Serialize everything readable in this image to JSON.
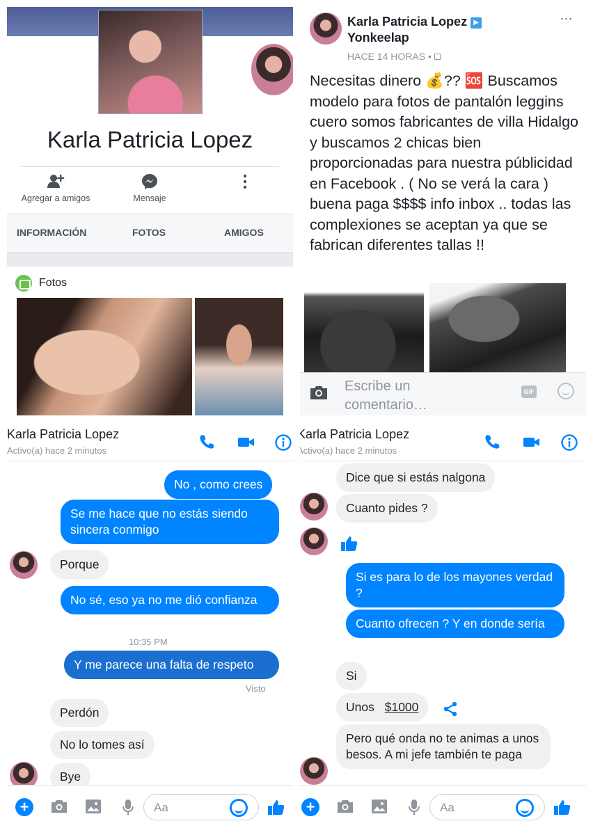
{
  "profile": {
    "name": "Karla Patricia Lopez",
    "actions": [
      {
        "label": "Agregar a amigos",
        "icon": "add-friend-icon"
      },
      {
        "label": "Mensaje",
        "icon": "messenger-icon"
      },
      {
        "label": "",
        "icon": "more-vertical-icon"
      }
    ],
    "tabs": [
      "INFORMACIÓN",
      "FOTOS",
      "AMIGOS"
    ],
    "photos_title": "Fotos"
  },
  "post": {
    "author": "Karla Patricia Lopez",
    "author_line2": "Yonkeelap",
    "time": "HACE 14 HORAS •",
    "text": "Necesitas dinero 💰?? 🆘 Buscamos modelo para fotos de pantalón leggins cuero somos fabricantes de villa Hidalgo y buscamos 2 chicas bien proporcionadas para nuestra públicidad en Facebook . ( No se verá la cara )  buena paga $$$$ info inbox ..  todas las complexiones se aceptan ya que se fabrican diferentes tallas !!",
    "more": "...",
    "comment_placeholder": "Escribe un comentario…",
    "gif_label": "GIF"
  },
  "chat1": {
    "name": "Karla Patricia Lopez",
    "status": "Activo(a) hace 2 minutos",
    "messages": [
      "No , como crees",
      "Se me hace que no estás siendo sincera conmigo",
      "Porque",
      "No sé, eso ya no me dió confianza",
      "Y me parece una falta de respeto",
      "Perdón",
      "No lo tomes así",
      "Bye"
    ],
    "time_separator": "10:35 PM",
    "seen": "Visto",
    "composer_placeholder": "Aa"
  },
  "chat2": {
    "name": "Karla Patricia Lopez",
    "status": "Activo(a) hace 2 minutos",
    "messages": [
      "Dice que si estás nalgona",
      "Cuanto pides ?",
      "Si es para lo de los mayones verdad ?",
      "Cuanto ofrecen ? Y en donde sería",
      "Si",
      "Unos",
      "$1000",
      "Pero qué onda no te animas a unos besos. A mi jefe también te paga"
    ],
    "composer_placeholder": "Aa"
  },
  "colors": {
    "messenger_blue": "#0084ff",
    "facebook_text": "#1d2129",
    "muted": "#90949c"
  }
}
